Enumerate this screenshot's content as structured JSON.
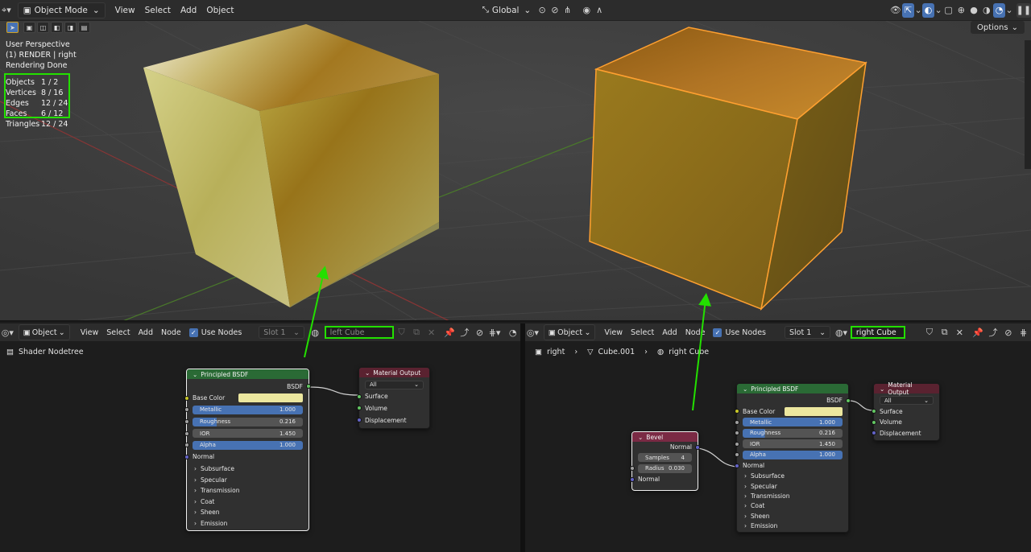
{
  "header": {
    "mode": "Object Mode",
    "menus": [
      "View",
      "Select",
      "Add",
      "Object"
    ],
    "transform": "Global"
  },
  "viewport": {
    "lines": [
      "User Perspective",
      "(1) RENDER | right",
      "Rendering Done"
    ],
    "stats": [
      {
        "k": "Objects",
        "v": "1 / 2"
      },
      {
        "k": "Vertices",
        "v": "8 / 16"
      },
      {
        "k": "Edges",
        "v": "12 / 24"
      },
      {
        "k": "Faces",
        "v": "6 / 12"
      },
      {
        "k": "Triangles",
        "v": "12 / 24"
      }
    ],
    "options": "Options"
  },
  "left_editor": {
    "mode": "Object",
    "menus": [
      "View",
      "Select",
      "Add",
      "Node"
    ],
    "use_nodes": "Use Nodes",
    "slot": "Slot 1",
    "material": "left Cube",
    "breadcrumb": "Shader Nodetree"
  },
  "right_editor": {
    "mode": "Object",
    "menus": [
      "View",
      "Select",
      "Add",
      "Node"
    ],
    "use_nodes": "Use Nodes",
    "slot": "Slot 1",
    "material": "right Cube",
    "breadcrumb": [
      "right",
      "Cube.001",
      "right Cube"
    ]
  },
  "principled": {
    "title": "Principled BSDF",
    "output": "BSDF",
    "base_color": "Base Color",
    "metallic": {
      "label": "Metallic",
      "value": "1.000"
    },
    "roughness": {
      "label": "Roughness",
      "value": "0.216"
    },
    "ior": {
      "label": "IOR",
      "value": "1.450"
    },
    "alpha": {
      "label": "Alpha",
      "value": "1.000"
    },
    "normal": "Normal",
    "panels": [
      "Subsurface",
      "Specular",
      "Transmission",
      "Coat",
      "Sheen",
      "Emission"
    ]
  },
  "material_output": {
    "title": "Material Output",
    "target": "All",
    "inputs": [
      "Surface",
      "Volume",
      "Displacement"
    ]
  },
  "bevel": {
    "title": "Bevel",
    "output": "Normal",
    "samples": {
      "label": "Samples",
      "value": "4"
    },
    "radius": {
      "label": "Radius",
      "value": "0.030"
    },
    "normal": "Normal"
  },
  "colors": {
    "base_color": "#ece79f",
    "highlight": "#23e000",
    "selection": "#ffa030"
  }
}
